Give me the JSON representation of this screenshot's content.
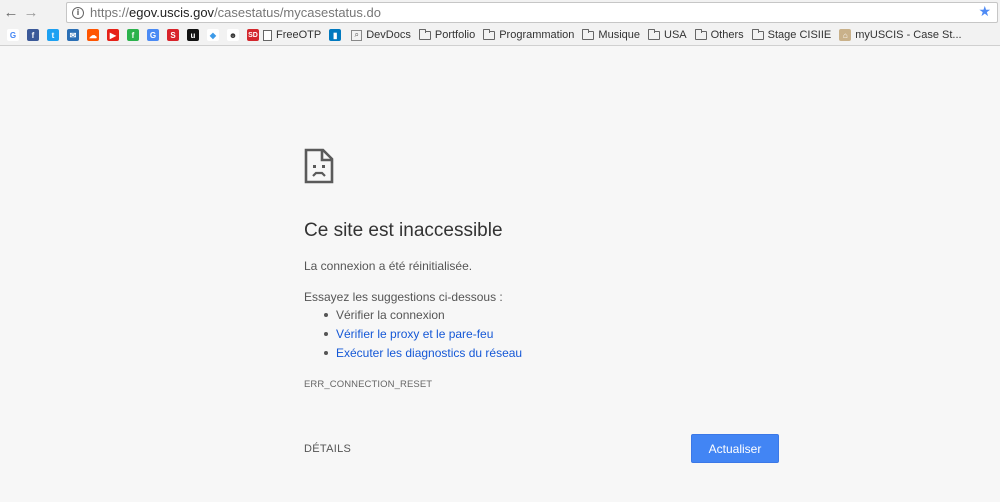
{
  "browser": {
    "back_glyph": "←",
    "forward_glyph": "→",
    "info_glyph": "i",
    "url_scheme": "https://",
    "url_host": "egov.uscis.gov",
    "url_path": "/casestatus/mycasestatus.do",
    "star_glyph": "★"
  },
  "bookmarks": {
    "icons": [
      {
        "name": "google-icon",
        "glyph": "G",
        "color": "#ffffff",
        "fg": "#4285f4"
      },
      {
        "name": "facebook-icon",
        "glyph": "f",
        "color": "#3b5998",
        "fg": "#ffffff"
      },
      {
        "name": "twitter-icon",
        "glyph": "t",
        "color": "#1da1f2",
        "fg": "#ffffff"
      },
      {
        "name": "mail-icon",
        "glyph": "✉",
        "color": "#2a6fb5",
        "fg": "#ffffff"
      },
      {
        "name": "soundcloud-icon",
        "glyph": "☁",
        "color": "#ff5500",
        "fg": "#ffffff"
      },
      {
        "name": "youtube-icon",
        "glyph": "▶",
        "color": "#e62117",
        "fg": "#ffffff"
      },
      {
        "name": "feedly-icon",
        "glyph": "f",
        "color": "#2bb24c",
        "fg": "#ffffff"
      },
      {
        "name": "translate-icon",
        "glyph": "G",
        "color": "#4a8af4",
        "fg": "#ffffff"
      },
      {
        "name": "swirl-icon",
        "glyph": "S",
        "color": "#d8232a",
        "fg": "#ffffff"
      },
      {
        "name": "u-logo-icon",
        "glyph": "u",
        "color": "#111111",
        "fg": "#ffffff"
      },
      {
        "name": "dropbox-icon",
        "glyph": "◆",
        "color": "#ffffff",
        "fg": "#3d9ae8"
      },
      {
        "name": "reddit-icon",
        "glyph": "☻",
        "color": "#ffffff",
        "fg": "#333333"
      },
      {
        "name": "sd-icon",
        "glyph": "SD",
        "color": "#d3272d",
        "fg": "#ffffff"
      }
    ],
    "items": [
      {
        "name": "bookmark-freeotp",
        "label": "FreeOTP",
        "icon": "page"
      },
      {
        "name": "bookmark-trello",
        "label": "",
        "icon": "trello"
      },
      {
        "name": "bookmark-devdocs",
        "label": "DevDocs",
        "icon": "mag"
      },
      {
        "name": "bookmark-portfolio",
        "label": "Portfolio",
        "icon": "folder"
      },
      {
        "name": "bookmark-programmation",
        "label": "Programmation",
        "icon": "folder"
      },
      {
        "name": "bookmark-musique",
        "label": "Musique",
        "icon": "folder"
      },
      {
        "name": "bookmark-usa",
        "label": "USA",
        "icon": "folder"
      },
      {
        "name": "bookmark-others",
        "label": "Others",
        "icon": "folder"
      },
      {
        "name": "bookmark-stage-cisiie",
        "label": "Stage CISIIE",
        "icon": "folder"
      },
      {
        "name": "bookmark-myuscis",
        "label": "myUSCIS - Case St...",
        "icon": "image"
      }
    ]
  },
  "error": {
    "title": "Ce site est inaccessible",
    "message": "La connexion a été réinitialisée.",
    "suggest_heading": "Essayez les suggestions ci-dessous :",
    "suggestions": [
      {
        "text": "Vérifier la connexion",
        "link": false
      },
      {
        "text": "Vérifier le proxy et le pare-feu",
        "link": true
      },
      {
        "text": "Exécuter les diagnostics du réseau",
        "link": true
      }
    ],
    "code": "ERR_CONNECTION_RESET",
    "details_label": "DÉTAILS",
    "reload_label": "Actualiser"
  },
  "colors": {
    "accent": "#4285f4",
    "link": "#1558d6",
    "page_bg": "#f7f7f7"
  }
}
